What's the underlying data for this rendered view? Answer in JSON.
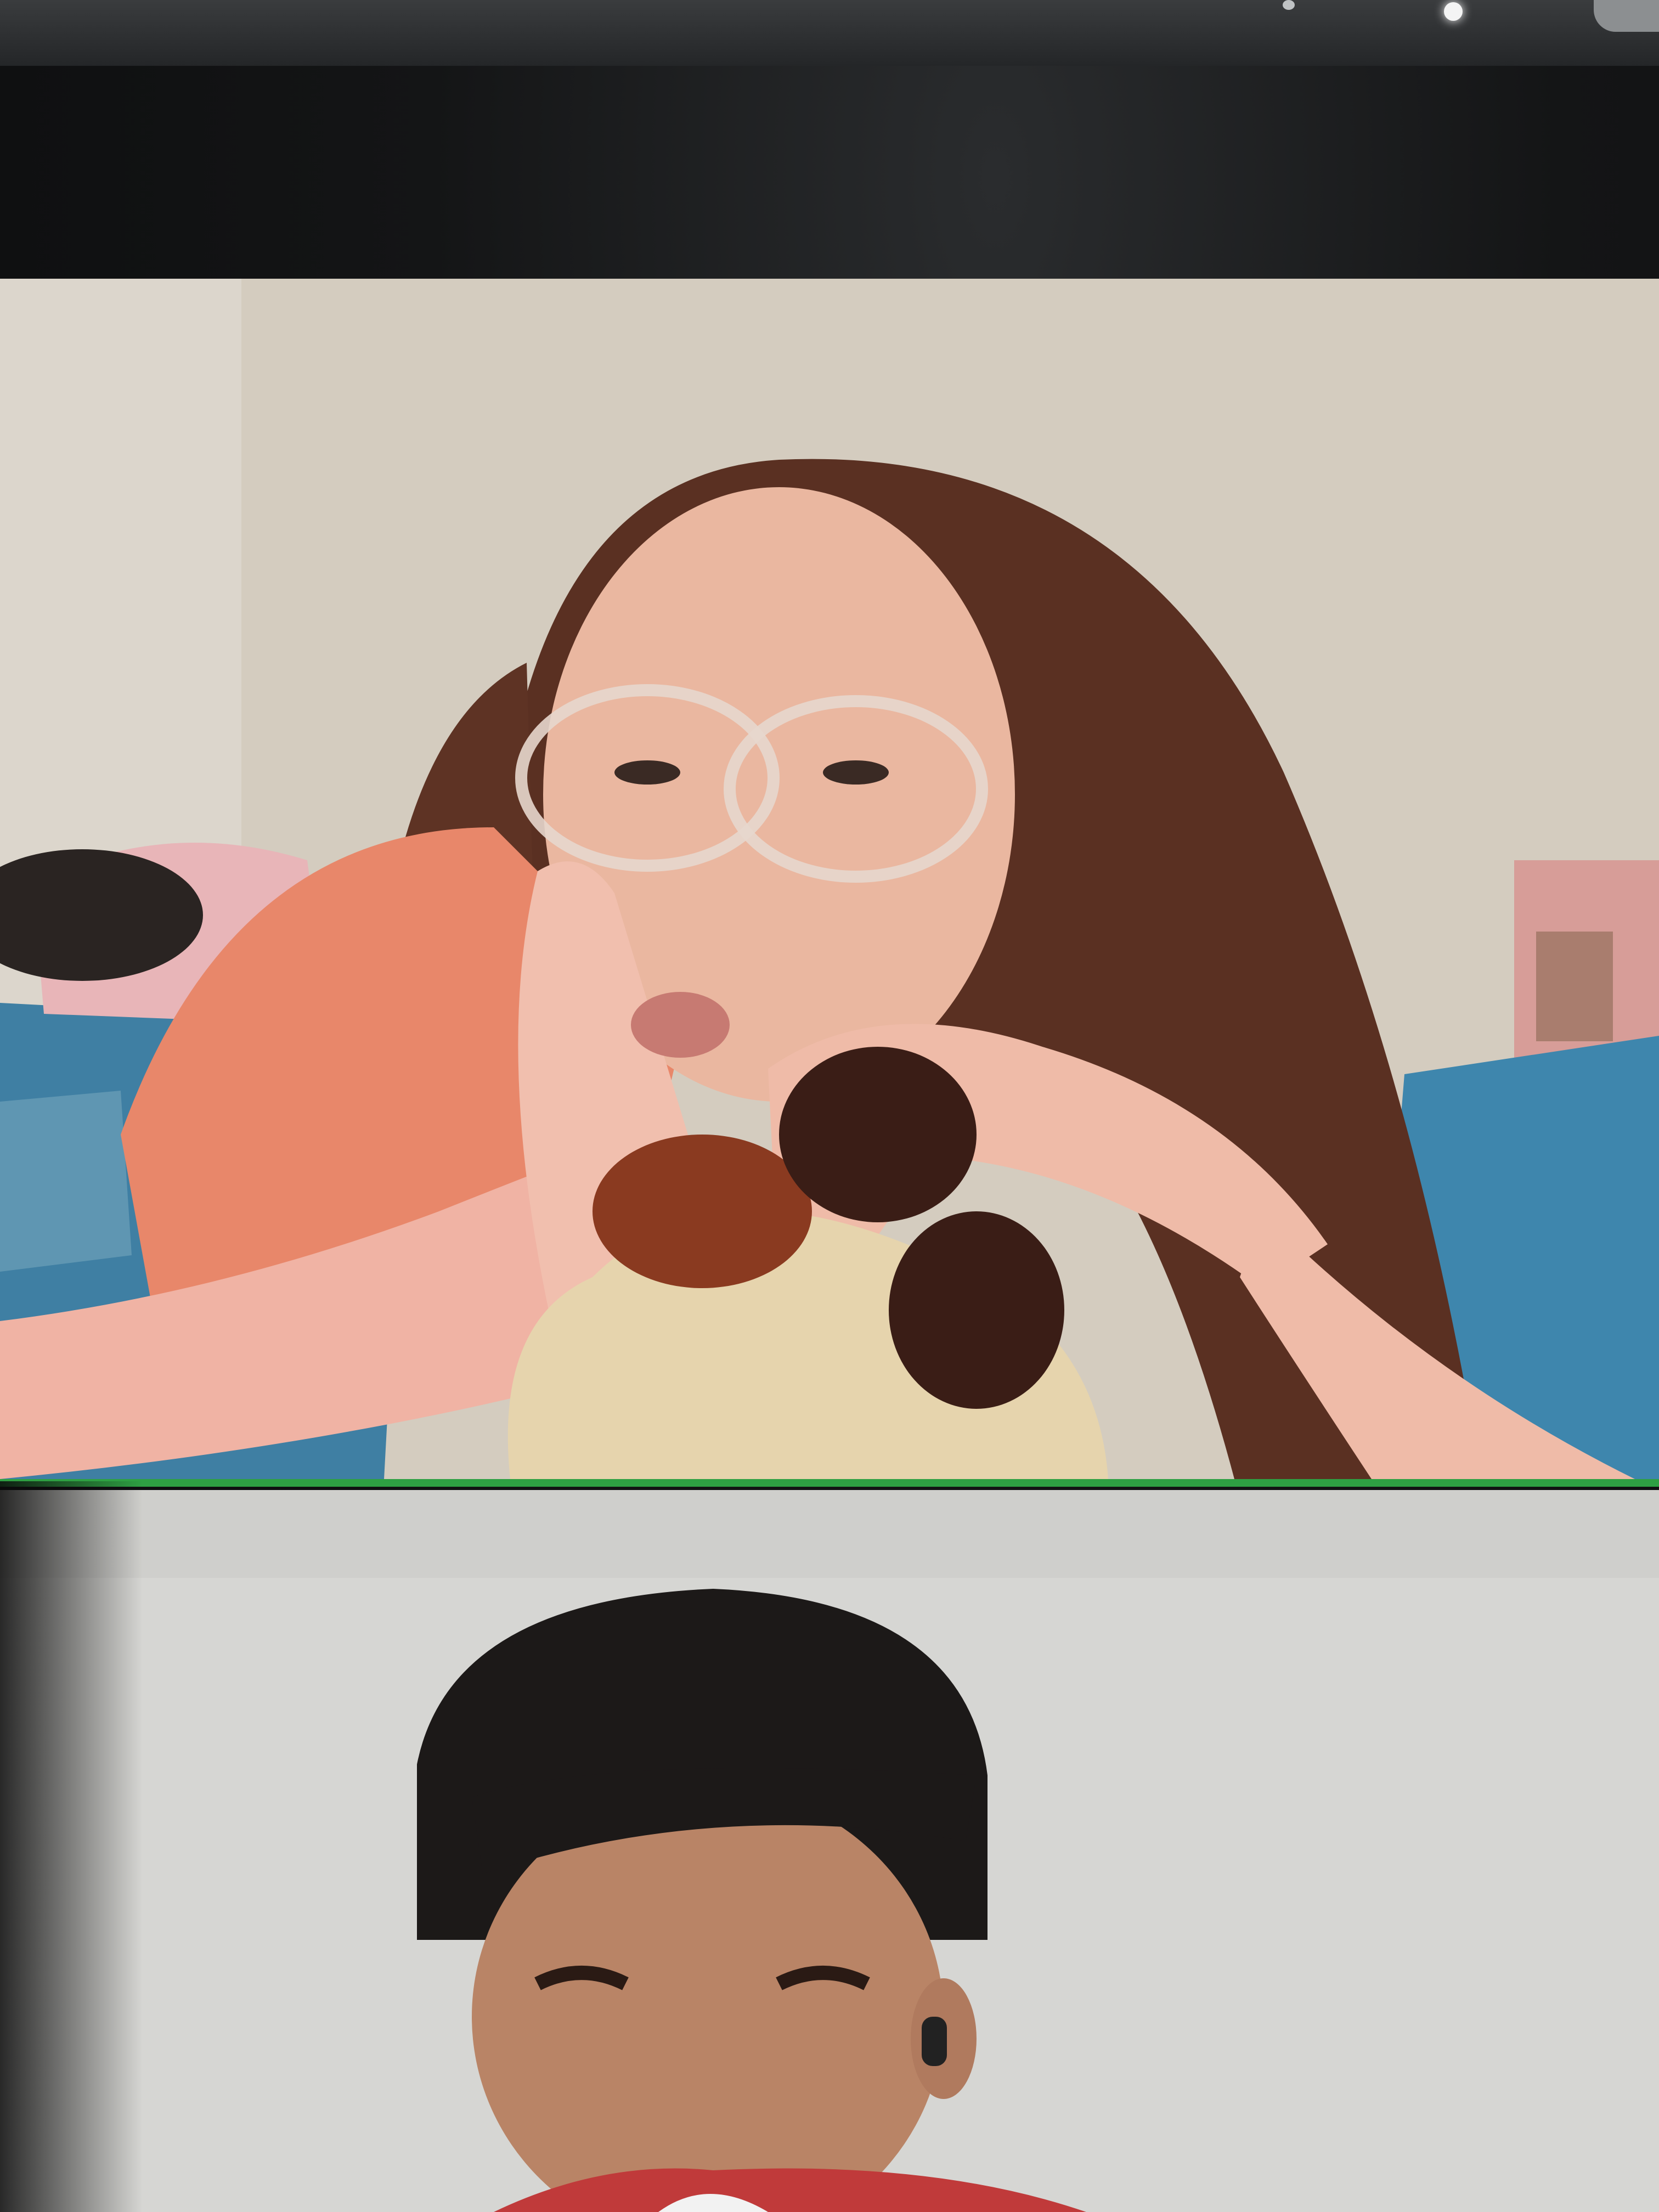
{
  "window": {
    "app": "video-call",
    "active_speaker_highlight": "#2ea043"
  },
  "participants": [
    {
      "tile": "top",
      "speaking": true
    },
    {
      "tile": "bottom",
      "speaking": false
    }
  ],
  "icons": {
    "camera": "camera-dot-icon"
  }
}
